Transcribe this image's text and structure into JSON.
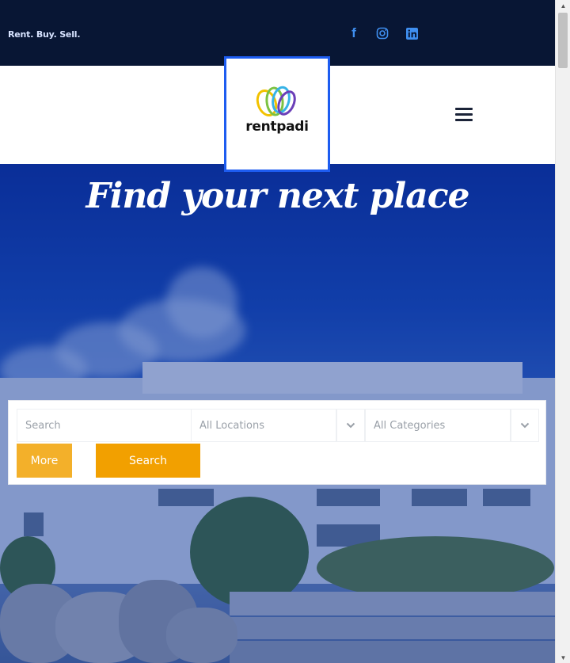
{
  "topbar": {
    "tagline": "Rent. Buy. Sell.",
    "social": [
      "facebook-icon",
      "instagram-icon",
      "linkedin-icon"
    ],
    "facebook_glyph": "f"
  },
  "header": {
    "logo_text": "rentpadi",
    "menu_icon": "hamburger-menu-icon"
  },
  "hero": {
    "title": "Find your next place"
  },
  "search": {
    "placeholder": "Search",
    "location_value": "All Locations",
    "category_value": "All Categories",
    "more_label": "More",
    "search_label": "Search"
  },
  "colors": {
    "topbar_bg": "#081634",
    "accent_blue": "#1d5cf0",
    "button_orange": "#f2a000",
    "more_orange": "#f3b02a"
  }
}
